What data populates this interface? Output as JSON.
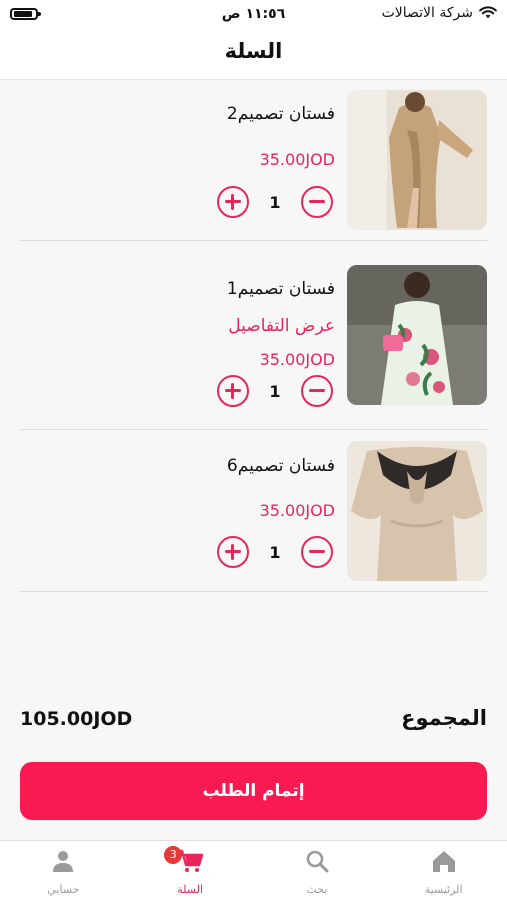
{
  "status_bar": {
    "carrier": "شركة الاتصالات",
    "time": "١١:٥٦ ص"
  },
  "header": {
    "title": "السلة"
  },
  "cart": {
    "items": [
      {
        "name": "فستان تصميم2",
        "link": "",
        "price": "35.00JOD",
        "quantity": "1"
      },
      {
        "name": "فستان تصميم1",
        "link": "عرض التفاصيل",
        "price": "35.00JOD",
        "quantity": "1"
      },
      {
        "name": "فستان تصميم6",
        "link": "",
        "price": "35.00JOD",
        "quantity": "1"
      }
    ]
  },
  "summary": {
    "total_label": "المجموع",
    "total_value": "105.00JOD"
  },
  "checkout": {
    "label": "إتمام الطلب"
  },
  "tab_bar": {
    "tabs": [
      {
        "label": "الرئيسية",
        "icon": "home-icon"
      },
      {
        "label": "بحث",
        "icon": "search-icon"
      },
      {
        "label": "السلة",
        "icon": "cart-icon",
        "badge": "3",
        "active": true
      },
      {
        "label": "حسابي",
        "icon": "person-icon"
      }
    ]
  },
  "colors": {
    "accent": "#e8265a",
    "button": "#f91a52",
    "badge": "#e53935"
  }
}
